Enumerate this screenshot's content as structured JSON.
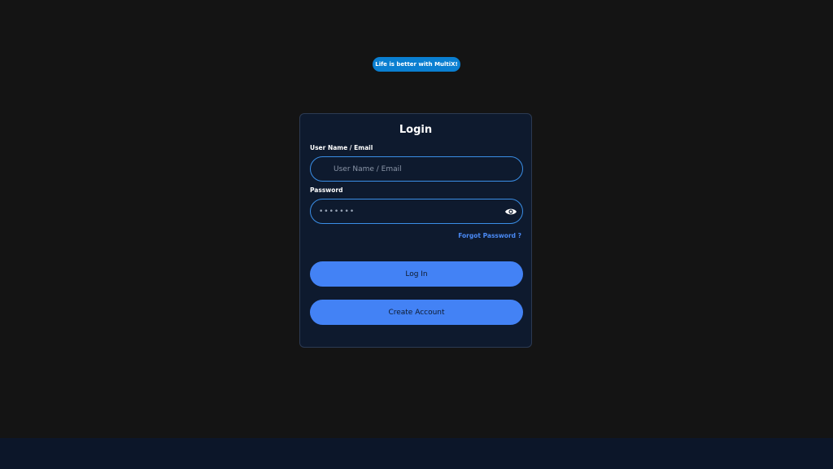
{
  "tagline": "Life is better with MultiX!",
  "login": {
    "title": "Login",
    "username": {
      "label": "User Name / Email",
      "placeholder": "User Name / Email",
      "value": ""
    },
    "password": {
      "label": "Password",
      "value": "•••••••"
    },
    "show_password_icon": "eye-icon",
    "forgot_password": "Forgot Password ?",
    "login_button": "Log In",
    "create_account_button": "Create Account"
  },
  "colors": {
    "background": "#141414",
    "card": "#0e1a2e",
    "accent": "#4382f5",
    "tagline_bg": "#0a7fd1",
    "footer": "#0c1629"
  }
}
